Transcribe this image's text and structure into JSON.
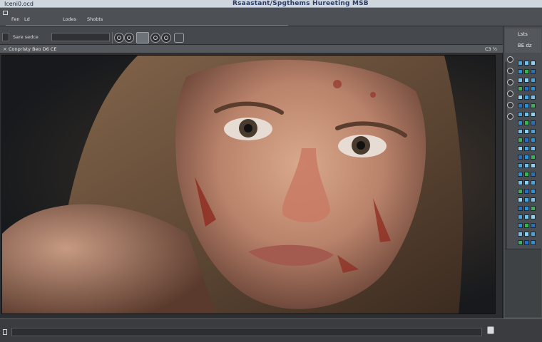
{
  "titlebar": {
    "app_name": "Iceni0.ocd",
    "window_title": "Rsaastant/Spgthems Hureeting MSB"
  },
  "menu": {
    "items": [
      "Fen",
      "Ld",
      "Lodes",
      "Shobts"
    ]
  },
  "toolbar": {
    "field_label": "Sare sedce"
  },
  "document": {
    "tab_label": "Conpristy Beo D6 CE",
    "zoom_label": "C3 ½"
  },
  "panel": {
    "title": "Lsts",
    "subtitle": "BE dz",
    "swatch_colors": [
      "#4aa3d9",
      "#2f8fd0",
      "#76c0e8",
      "#3fae5a",
      "#8fd0f0",
      "#2a6fb8"
    ]
  },
  "colors": {
    "title_text": "#2a3d66",
    "title_bg": "#cfd6de",
    "chrome_dark": "#3b3d40",
    "accent_blue": "#4aa3d9"
  },
  "icons": {
    "close": "×"
  }
}
